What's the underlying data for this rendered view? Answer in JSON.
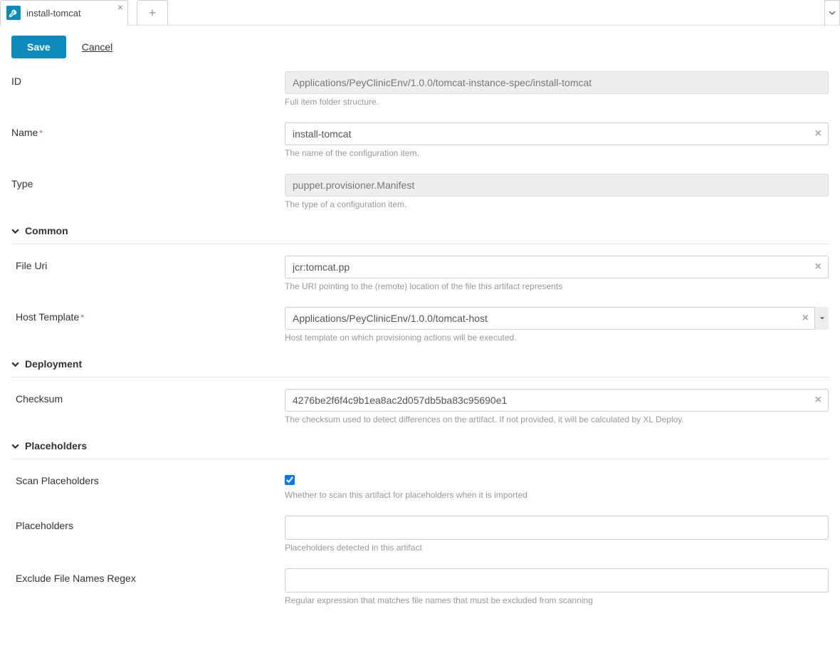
{
  "tab": {
    "title": "install-tomcat"
  },
  "toolbar": {
    "save": "Save",
    "cancel": "Cancel"
  },
  "fields": {
    "id": {
      "label": "ID",
      "value": "Applications/PeyClinicEnv/1.0.0/tomcat-instance-spec/install-tomcat",
      "help": "Full item folder structure."
    },
    "name": {
      "label": "Name",
      "value": "install-tomcat",
      "help": "The name of the configuration item."
    },
    "type": {
      "label": "Type",
      "value": "puppet.provisioner.Manifest",
      "help": "The type of a configuration item."
    },
    "fileUri": {
      "label": "File Uri",
      "value": "jcr:tomcat.pp",
      "help": "The URI pointing to the (remote) location of the file this artifact represents"
    },
    "hostTemplate": {
      "label": "Host Template",
      "value": "Applications/PeyClinicEnv/1.0.0/tomcat-host",
      "help": "Host template on which provisioning actions will be executed."
    },
    "checksum": {
      "label": "Checksum",
      "value": "4276be2f6f4c9b1ea8ac2d057db5ba83c95690e1",
      "help": "The checksum used to detect differences on the artifact. If not provided, it will be calculated by XL Deploy."
    },
    "scanPlaceholders": {
      "label": "Scan Placeholders",
      "help": "Whether to scan this artifact for placeholders when it is imported"
    },
    "placeholders": {
      "label": "Placeholders",
      "help": "Placeholders detected in this artifact"
    },
    "excludeFileNamesRegex": {
      "label": "Exclude File Names Regex",
      "help": "Regular expression that matches file names that must be excluded from scanning"
    }
  },
  "sections": {
    "common": "Common",
    "deployment": "Deployment",
    "placeholders": "Placeholders"
  }
}
